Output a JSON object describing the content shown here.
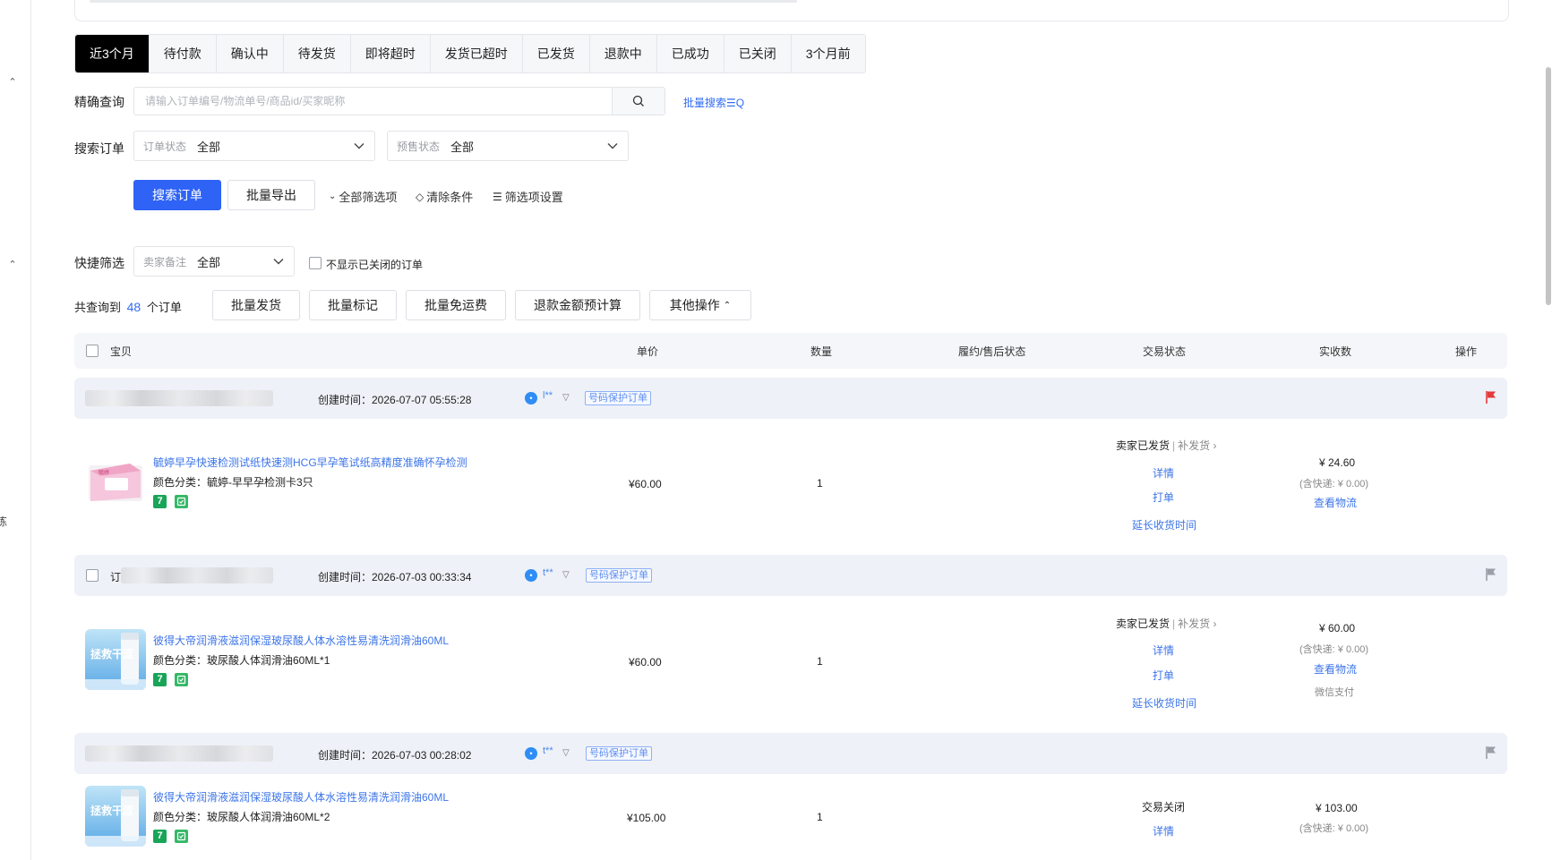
{
  "tabs": [
    "近3个月",
    "待付款",
    "确认中",
    "待发货",
    "即将超时",
    "发货已超时",
    "已发货",
    "退款中",
    "已成功",
    "已关闭",
    "3个月前"
  ],
  "active_tab": "近3个月",
  "search": {
    "label": "精确查询",
    "placeholder": "请输入订单编号/物流单号/商品id/买家昵称",
    "batch_search": "批量搜索☰Q"
  },
  "filter": {
    "label": "搜索订单",
    "order_status_label": "订单状态",
    "order_status_value": "全部",
    "presale_status_label": "预售状态",
    "presale_status_value": "全部"
  },
  "actions": {
    "search_button": "搜索订单",
    "export_button": "批量导出",
    "all_filters": "全部筛选项",
    "clear_conditions": "清除条件",
    "filter_settings": "筛选项设置"
  },
  "quick_filter": {
    "label": "快捷筛选",
    "remark_label": "卖家备注",
    "remark_value": "全部",
    "hide_closed": "不显示已关闭的订单"
  },
  "summary": {
    "prefix": "共查询到",
    "count": "48",
    "suffix": "个订单"
  },
  "bulk_buttons": {
    "ship": "批量发货",
    "mark": "批量标记",
    "free_shipping": "批量免运费",
    "refund_calc": "退款金额预计算",
    "other": "其他操作"
  },
  "table_headers": {
    "item": "宝贝",
    "unit_price": "单价",
    "quantity": "数量",
    "after_sale": "履约/售后状态",
    "trade_status": "交易状态",
    "received": "实收数",
    "operation": "操作"
  },
  "orders": [
    {
      "order_prefix": "",
      "created": "创建时间：2026-07-07 05:55:28",
      "buyer": "l**",
      "protect_tag": "号码保护订单",
      "flag_color": "#e23b3b",
      "item_title": "毓婷早孕快速检测试纸快速测HCG早孕笔试纸高精度准确怀孕检测",
      "item_sku": "颜色分类：毓婷-早早孕检测卡3只",
      "unit_price": "¥60.00",
      "quantity": "1",
      "status_main": "卖家已发货",
      "status_sub": "补发货",
      "detail": "详情",
      "print": "打单",
      "extend": "延长收货时间",
      "received": "¥ 24.60",
      "shipping_note": "(含快递: ¥ 0.00)",
      "logistics": "查看物流",
      "pay_method": ""
    },
    {
      "order_prefix": "订",
      "created": "创建时间：2026-07-03 00:33:34",
      "buyer": "t**",
      "protect_tag": "号码保护订单",
      "flag_color": "#9a9ea6",
      "item_title": "彼得大帝润滑液滋润保湿玻尿酸人体水溶性易清洗润滑油60ML",
      "item_sku": "颜色分类：玻尿酸人体润滑油60ML*1",
      "unit_price": "¥60.00",
      "quantity": "1",
      "status_main": "卖家已发货",
      "status_sub": "补发货",
      "detail": "详情",
      "print": "打单",
      "extend": "延长收货时间",
      "received": "¥ 60.00",
      "shipping_note": "(含快递: ¥ 0.00)",
      "logistics": "查看物流",
      "pay_method": "微信支付"
    },
    {
      "order_prefix": "",
      "created": "创建时间：2026-07-03 00:28:02",
      "buyer": "t**",
      "protect_tag": "号码保护订单",
      "flag_color": "#9a9ea6",
      "item_title": "彼得大帝润滑液滋润保湿玻尿酸人体水溶性易清洗润滑油60ML",
      "item_sku": "颜色分类：玻尿酸人体润滑油60ML*2",
      "unit_price": "¥105.00",
      "quantity": "1",
      "status_main": "交易关闭",
      "detail": "详情",
      "received": "¥ 103.00",
      "shipping_note": "(含快递: ¥ 0.00)"
    }
  ],
  "thumb_text": "拯救干涩",
  "thumb_brand": "毓婷",
  "rail_fragment": "练",
  "colors": {
    "primary": "#2f63f5",
    "link": "#3c74e8",
    "active_tab_bg": "#000000",
    "order_head_bg": "#eef1f7"
  }
}
